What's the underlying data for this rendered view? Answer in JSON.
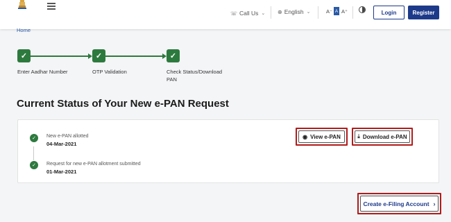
{
  "header": {
    "call_us": "Call Us",
    "language": "English",
    "font_decrease": "A⁻",
    "font_normal": "A",
    "font_increase": "A⁺",
    "login": "Login",
    "register": "Register"
  },
  "breadcrumb": "Home",
  "steps": [
    {
      "label": "Enter Aadhar Number"
    },
    {
      "label": "OTP Validation"
    },
    {
      "label": "Check Status/Download PAN"
    }
  ],
  "page_title": "Current Status of Your New e-PAN Request",
  "timeline": [
    {
      "title": "New e-PAN allotted",
      "date": "04-Mar-2021"
    },
    {
      "title": "Request for new e-PAN allotment submitted",
      "date": "01-Mar-2021"
    }
  ],
  "actions": {
    "view": "View e-PAN",
    "download": "Download e-PAN",
    "create": "Create e-Filing Account"
  },
  "colors": {
    "primary": "#1d3a8a",
    "success": "#2d7a3e",
    "highlight": "#b11b1b"
  }
}
